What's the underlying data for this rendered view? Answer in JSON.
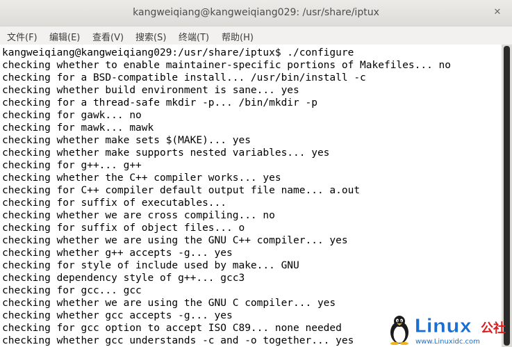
{
  "window": {
    "title": "kangweiqiang@kangweiqiang029: /usr/share/iptux",
    "close_glyph": "✕"
  },
  "menubar": {
    "items": [
      {
        "label": "文件(F)"
      },
      {
        "label": "编辑(E)"
      },
      {
        "label": "查看(V)"
      },
      {
        "label": "搜索(S)"
      },
      {
        "label": "终端(T)"
      },
      {
        "label": "帮助(H)"
      }
    ]
  },
  "terminal": {
    "lines": [
      "kangweiqiang@kangweiqiang029:/usr/share/iptux$ ./configure",
      "checking whether to enable maintainer-specific portions of Makefiles... no",
      "checking for a BSD-compatible install... /usr/bin/install -c",
      "checking whether build environment is sane... yes",
      "checking for a thread-safe mkdir -p... /bin/mkdir -p",
      "checking for gawk... no",
      "checking for mawk... mawk",
      "checking whether make sets $(MAKE)... yes",
      "checking whether make supports nested variables... yes",
      "checking for g++... g++",
      "checking whether the C++ compiler works... yes",
      "checking for C++ compiler default output file name... a.out",
      "checking for suffix of executables...",
      "checking whether we are cross compiling... no",
      "checking for suffix of object files... o",
      "checking whether we are using the GNU C++ compiler... yes",
      "checking whether g++ accepts -g... yes",
      "checking for style of include used by make... GNU",
      "checking dependency style of g++... gcc3",
      "checking for gcc... gcc",
      "checking whether we are using the GNU C compiler... yes",
      "checking whether gcc accepts -g... yes",
      "checking for gcc option to accept ISO C89... none needed",
      "checking whether gcc understands -c and -o together... yes"
    ]
  },
  "watermark": {
    "brand": "Linux",
    "brand_cn": "公社",
    "url": "www.Linuxidc.com"
  },
  "colors": {
    "terminal_bg": "#ffffff",
    "terminal_fg": "#000000",
    "brand_blue": "#1a6fd1",
    "brand_red": "#d81e1e"
  }
}
